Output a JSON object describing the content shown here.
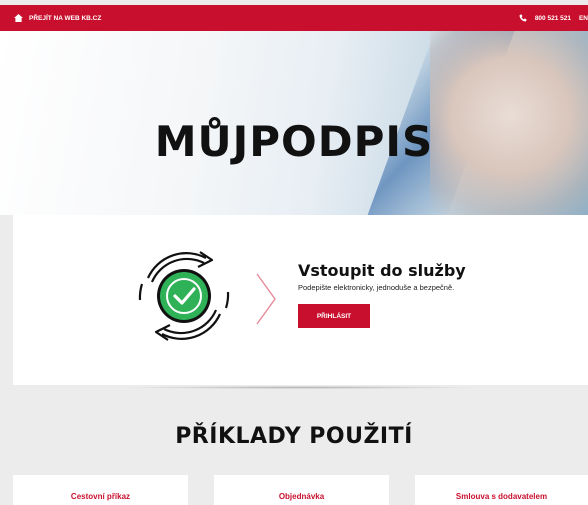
{
  "topbar": {
    "home_icon": "home-icon",
    "link_label": "PŘEJÍT NA WEB KB.CZ",
    "phone_icon": "phone-icon",
    "phone": "800 521 521",
    "language": "EN"
  },
  "hero": {
    "title": "MŮJPODPIS"
  },
  "login": {
    "title": "Vstoupit do služby",
    "subtitle": "Podepište elektronicky, jednoduše a bezpečně.",
    "button_label": "PŘIHLÁSIT"
  },
  "examples": {
    "title": "PŘÍKLADY POUŽITÍ",
    "items": [
      {
        "label": "Cestovní příkaz"
      },
      {
        "label": "Objednávka"
      },
      {
        "label": "Smlouva s dodavatelem"
      }
    ]
  },
  "colors": {
    "brand_red": "#c8102e",
    "check_green": "#2eb157"
  }
}
